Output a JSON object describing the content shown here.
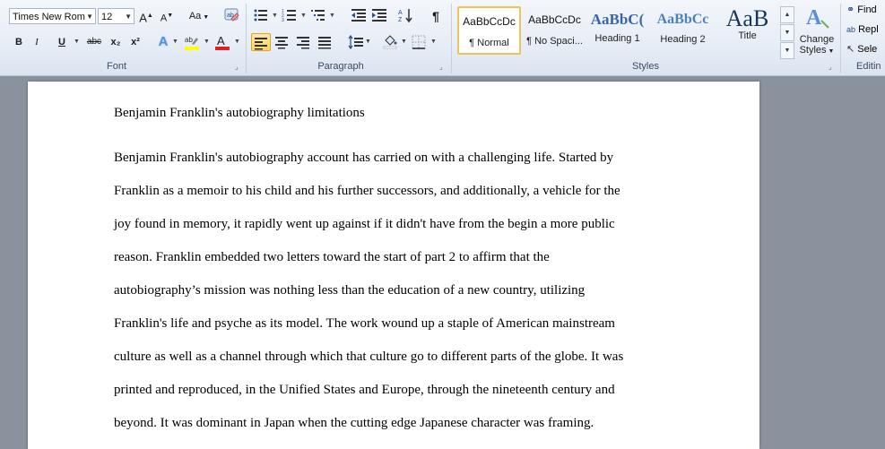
{
  "font": {
    "name": "Times New Rom",
    "size": "12",
    "group_label": "Font",
    "buttons": {
      "bold": "B",
      "italic": "I",
      "underline": "U",
      "strikethrough": "abc",
      "subscript": "x₂",
      "superscript": "x²",
      "change_case": "Aa"
    }
  },
  "paragraph": {
    "group_label": "Paragraph"
  },
  "styles": {
    "group_label": "Styles",
    "items": [
      {
        "sample": "AaBbCcDc",
        "name": "¶ Normal"
      },
      {
        "sample": "AaBbCcDc",
        "name": "¶ No Spaci..."
      },
      {
        "sample": "AaBbC(",
        "name": "Heading 1"
      },
      {
        "sample": "AaBbCc",
        "name": "Heading 2"
      },
      {
        "sample": "AaB",
        "name": "Title"
      }
    ],
    "change_styles_line1": "Change",
    "change_styles_line2": "Styles"
  },
  "editing": {
    "group_label": "Editin",
    "find": "Find",
    "replace": "Repl",
    "select": "Sele"
  },
  "colors": {
    "highlight": "#ffff00",
    "font_color": "#e02020",
    "accent_active": "#ffd36a",
    "heading": "#3a64a8"
  },
  "document": {
    "title": "Benjamin Franklin's  autobiography limitations",
    "lines": [
      "Benjamin Franklin's  autobiography account has carried on with a challenging life. Started by",
      "Franklin as a memoir to his child and his further successors, and additionally, a vehicle for the",
      "joy found in memory, it rapidly went up against if it didn't have from the begin a more public",
      "reason. Franklin embedded two letters toward the start of part 2 to affirm that the",
      "autobiography’s mission was nothing less than the education of a new country, utilizing",
      "Franklin's life and psyche as its model. The work wound up a staple of American mainstream",
      "culture as well as a channel through which that culture go to different parts of the globe. It was",
      "printed and reproduced, in the Unified States and Europe, through the nineteenth century and",
      "beyond. It was dominant in Japan when the cutting edge Japanese character was framing."
    ]
  }
}
